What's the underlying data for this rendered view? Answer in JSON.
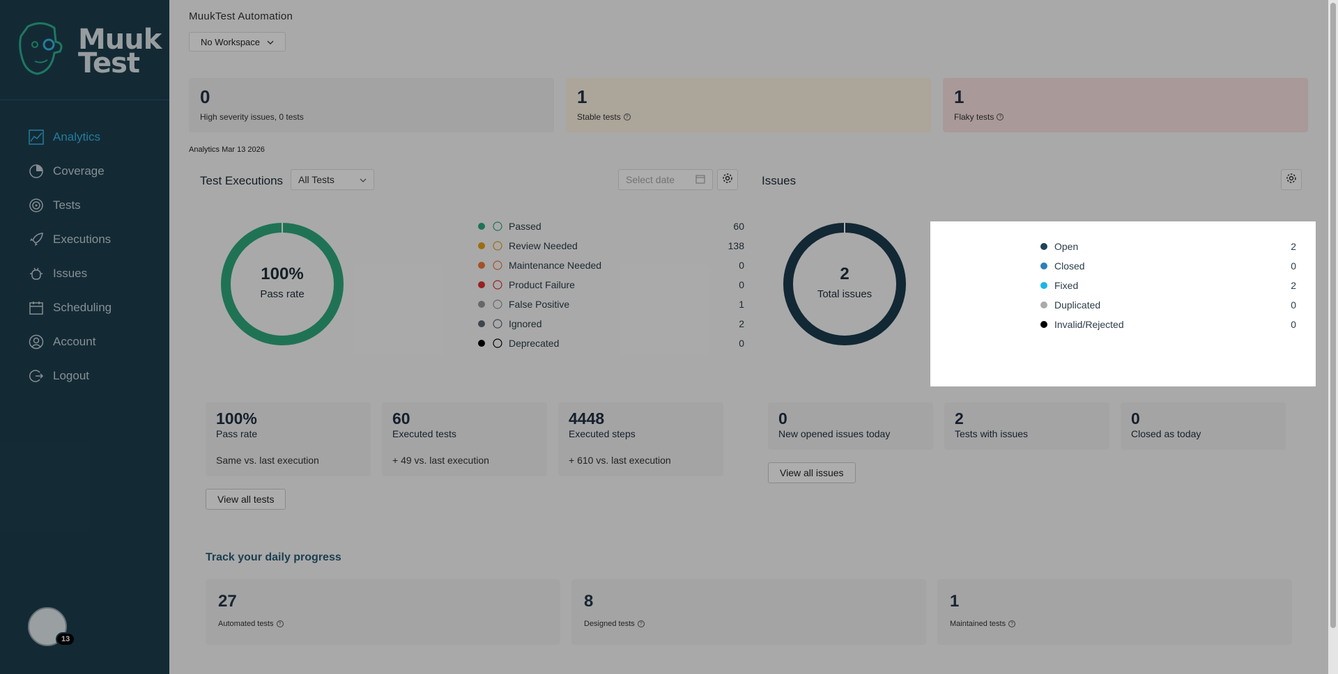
{
  "sidebar": {
    "logo_line1": "Muuk",
    "logo_line2": "Test",
    "items": [
      {
        "label": "Analytics",
        "icon": "chart-icon"
      },
      {
        "label": "Coverage",
        "icon": "pie-icon"
      },
      {
        "label": "Tests",
        "icon": "target-icon"
      },
      {
        "label": "Executions",
        "icon": "rocket-icon"
      },
      {
        "label": "Issues",
        "icon": "bug-icon"
      },
      {
        "label": "Scheduling",
        "icon": "calendar-icon"
      },
      {
        "label": "Account",
        "icon": "user-icon"
      },
      {
        "label": "Logout",
        "icon": "logout-icon"
      }
    ],
    "badge_count": "13",
    "accent": "#35b7e5",
    "bg": "#1d3f4f"
  },
  "header": {
    "app_title": "MuukTest Automation",
    "workspace": "No Workspace"
  },
  "top_stats": [
    {
      "num": "0",
      "label": "High severity issues, 0 tests"
    },
    {
      "num": "1",
      "label": "Stable tests"
    },
    {
      "num": "1",
      "label": "Flaky tests"
    }
  ],
  "analytics_date": "Analytics Mar 13 2026",
  "executions": {
    "title": "Test Executions",
    "filter": "All Tests",
    "date_placeholder": "Select date",
    "pct": "100%",
    "pct_label": "Pass rate",
    "legend": [
      {
        "name": "Passed",
        "value": "60",
        "color": "#2faa7c"
      },
      {
        "name": "Review Needed",
        "value": "138",
        "color": "#e6a117"
      },
      {
        "name": "Maintenance Needed",
        "value": "0",
        "color": "#f07a3a"
      },
      {
        "name": "Product Failure",
        "value": "0",
        "color": "#e03131"
      },
      {
        "name": "False Positive",
        "value": "1",
        "color": "#999999"
      },
      {
        "name": "Ignored",
        "value": "2",
        "color": "#5c6770"
      },
      {
        "name": "Deprecated",
        "value": "0",
        "color": "#000000"
      }
    ],
    "kpis": [
      {
        "num": "100%",
        "label": "Pass rate",
        "sub": "Same vs. last execution"
      },
      {
        "num": "60",
        "label": "Executed tests",
        "sub": "+ 49 vs. last execution"
      },
      {
        "num": "4448",
        "label": "Executed steps",
        "sub": "+ 610 vs. last execution"
      }
    ],
    "view_all": "View all tests"
  },
  "issues": {
    "title": "Issues",
    "total": "2",
    "total_label": "Total issues",
    "legend": [
      {
        "name": "Open",
        "value": "2",
        "color": "#1f4257"
      },
      {
        "name": "Closed",
        "value": "0",
        "color": "#2b7fb8"
      },
      {
        "name": "Fixed",
        "value": "2",
        "color": "#19b6e6"
      },
      {
        "name": "Duplicated",
        "value": "0",
        "color": "#aaaaaa"
      },
      {
        "name": "Invalid/Rejected",
        "value": "0",
        "color": "#000000"
      }
    ],
    "kpis": [
      {
        "num": "0",
        "label": "New opened issues today"
      },
      {
        "num": "2",
        "label": "Tests with issues"
      },
      {
        "num": "0",
        "label": "Closed as today"
      }
    ],
    "view_all": "View all issues"
  },
  "progress": {
    "title": "Track your daily progress",
    "cards": [
      {
        "num": "27",
        "label": "Automated tests"
      },
      {
        "num": "8",
        "label": "Designed tests"
      },
      {
        "num": "1",
        "label": "Maintained tests"
      }
    ]
  }
}
